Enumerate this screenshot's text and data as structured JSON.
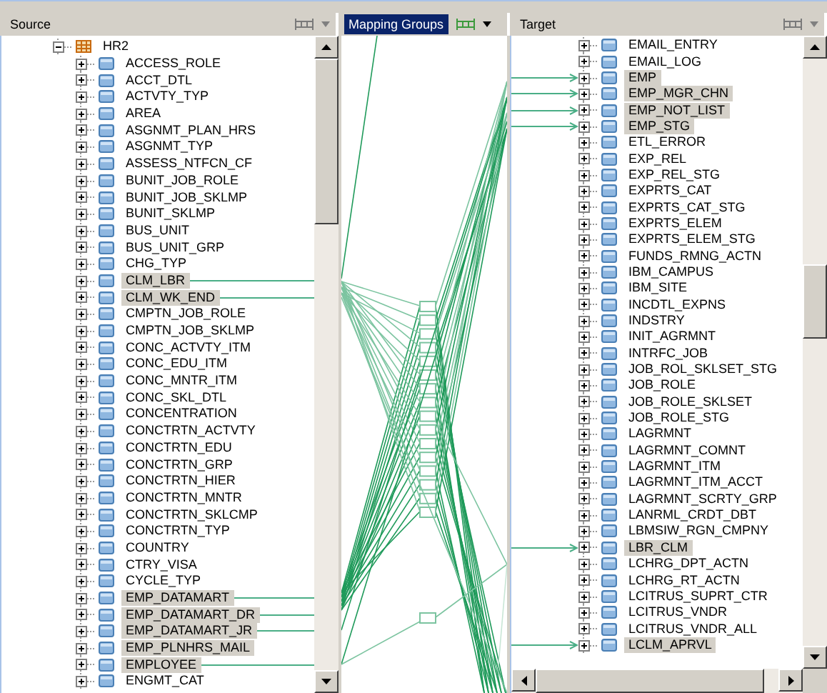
{
  "panes": [
    {
      "title": "Source",
      "selected": false
    },
    {
      "title": "Mapping Groups",
      "selected": true
    },
    {
      "title": "Target",
      "selected": false
    }
  ],
  "source": {
    "root": {
      "label": "HR2",
      "expanded": true,
      "children": [
        {
          "label": "ACCESS_ROLE",
          "expanded": false,
          "mapped": false,
          "linked": false
        },
        {
          "label": "ACCT_DTL",
          "expanded": false,
          "mapped": false,
          "linked": false
        },
        {
          "label": "ACTVTY_TYP",
          "expanded": false,
          "mapped": false,
          "linked": false
        },
        {
          "label": "AREA",
          "expanded": false,
          "mapped": false,
          "linked": false
        },
        {
          "label": "ASGNMT_PLAN_HRS",
          "expanded": false,
          "mapped": false,
          "linked": false
        },
        {
          "label": "ASGNMT_TYP",
          "expanded": false,
          "mapped": false,
          "linked": false
        },
        {
          "label": "ASSESS_NTFCN_CF",
          "expanded": false,
          "mapped": false,
          "linked": false
        },
        {
          "label": "BUNIT_JOB_ROLE",
          "expanded": false,
          "mapped": false,
          "linked": false
        },
        {
          "label": "BUNIT_JOB_SKLMP",
          "expanded": false,
          "mapped": false,
          "linked": false
        },
        {
          "label": "BUNIT_SKLMP",
          "expanded": false,
          "mapped": false,
          "linked": false
        },
        {
          "label": "BUS_UNIT",
          "expanded": false,
          "mapped": false,
          "linked": false
        },
        {
          "label": "BUS_UNIT_GRP",
          "expanded": false,
          "mapped": false,
          "linked": false
        },
        {
          "label": "CHG_TYP",
          "expanded": false,
          "mapped": false,
          "linked": false
        },
        {
          "label": "CLM_LBR",
          "expanded": false,
          "mapped": true,
          "linked": true
        },
        {
          "label": "CLM_WK_END",
          "expanded": false,
          "mapped": true,
          "linked": true
        },
        {
          "label": "CMPTN_JOB_ROLE",
          "expanded": false,
          "mapped": false,
          "linked": false
        },
        {
          "label": "CMPTN_JOB_SKLMP",
          "expanded": false,
          "mapped": false,
          "linked": false
        },
        {
          "label": "CONC_ACTVTY_ITM",
          "expanded": false,
          "mapped": false,
          "linked": false
        },
        {
          "label": "CONC_EDU_ITM",
          "expanded": false,
          "mapped": false,
          "linked": false
        },
        {
          "label": "CONC_MNTR_ITM",
          "expanded": false,
          "mapped": false,
          "linked": false
        },
        {
          "label": "CONC_SKL_DTL",
          "expanded": false,
          "mapped": false,
          "linked": false
        },
        {
          "label": "CONCENTRATION",
          "expanded": false,
          "mapped": false,
          "linked": false
        },
        {
          "label": "CONCTRTN_ACTVTY",
          "expanded": false,
          "mapped": false,
          "linked": false
        },
        {
          "label": "CONCTRTN_EDU",
          "expanded": false,
          "mapped": false,
          "linked": false
        },
        {
          "label": "CONCTRTN_GRP",
          "expanded": false,
          "mapped": false,
          "linked": false
        },
        {
          "label": "CONCTRTN_HIER",
          "expanded": false,
          "mapped": false,
          "linked": false
        },
        {
          "label": "CONCTRTN_MNTR",
          "expanded": false,
          "mapped": false,
          "linked": false
        },
        {
          "label": "CONCTRTN_SKLCMP",
          "expanded": false,
          "mapped": false,
          "linked": false
        },
        {
          "label": "CONCTRTN_TYP",
          "expanded": false,
          "mapped": false,
          "linked": false
        },
        {
          "label": "COUNTRY",
          "expanded": false,
          "mapped": false,
          "linked": false
        },
        {
          "label": "CTRY_VISA",
          "expanded": false,
          "mapped": false,
          "linked": false
        },
        {
          "label": "CYCLE_TYP",
          "expanded": false,
          "mapped": false,
          "linked": false
        },
        {
          "label": "EMP_DATAMART",
          "expanded": false,
          "mapped": true,
          "linked": true
        },
        {
          "label": "EMP_DATAMART_DR",
          "expanded": false,
          "mapped": true,
          "linked": true
        },
        {
          "label": "EMP_DATAMART_JR",
          "expanded": false,
          "mapped": true,
          "linked": true
        },
        {
          "label": "EMP_PLNHRS_MAIL",
          "expanded": false,
          "mapped": true,
          "linked": false
        },
        {
          "label": "EMPLOYEE",
          "expanded": false,
          "mapped": true,
          "linked": true
        },
        {
          "label": "ENGMT_CAT",
          "expanded": false,
          "mapped": false,
          "linked": false
        }
      ]
    }
  },
  "target": {
    "items": [
      {
        "label": "EMAIL_ENTRY",
        "expanded": false,
        "mapped": false,
        "linked": false
      },
      {
        "label": "EMAIL_LOG",
        "expanded": false,
        "mapped": false,
        "linked": false
      },
      {
        "label": "EMP",
        "expanded": false,
        "mapped": true,
        "linked": true
      },
      {
        "label": "EMP_MGR_CHN",
        "expanded": false,
        "mapped": true,
        "linked": true
      },
      {
        "label": "EMP_NOT_LIST",
        "expanded": false,
        "mapped": true,
        "linked": true
      },
      {
        "label": "EMP_STG",
        "expanded": false,
        "mapped": true,
        "linked": true
      },
      {
        "label": "ETL_ERROR",
        "expanded": false,
        "mapped": false,
        "linked": false
      },
      {
        "label": "EXP_REL",
        "expanded": false,
        "mapped": false,
        "linked": false
      },
      {
        "label": "EXP_REL_STG",
        "expanded": false,
        "mapped": false,
        "linked": false
      },
      {
        "label": "EXPRTS_CAT",
        "expanded": false,
        "mapped": false,
        "linked": false
      },
      {
        "label": "EXPRTS_CAT_STG",
        "expanded": false,
        "mapped": false,
        "linked": false
      },
      {
        "label": "EXPRTS_ELEM",
        "expanded": false,
        "mapped": false,
        "linked": false
      },
      {
        "label": "EXPRTS_ELEM_STG",
        "expanded": false,
        "mapped": false,
        "linked": false
      },
      {
        "label": "FUNDS_RMNG_ACTN",
        "expanded": false,
        "mapped": false,
        "linked": false
      },
      {
        "label": "IBM_CAMPUS",
        "expanded": false,
        "mapped": false,
        "linked": false
      },
      {
        "label": "IBM_SITE",
        "expanded": false,
        "mapped": false,
        "linked": false
      },
      {
        "label": "INCDTL_EXPNS",
        "expanded": false,
        "mapped": false,
        "linked": false
      },
      {
        "label": "INDSTRY",
        "expanded": false,
        "mapped": false,
        "linked": false
      },
      {
        "label": "INIT_AGRMNT",
        "expanded": false,
        "mapped": false,
        "linked": false
      },
      {
        "label": "INTRFC_JOB",
        "expanded": false,
        "mapped": false,
        "linked": false
      },
      {
        "label": "JOB_ROL_SKLSET_STG",
        "expanded": false,
        "mapped": false,
        "linked": false
      },
      {
        "label": "JOB_ROLE",
        "expanded": false,
        "mapped": false,
        "linked": false
      },
      {
        "label": "JOB_ROLE_SKLSET",
        "expanded": false,
        "mapped": false,
        "linked": false
      },
      {
        "label": "JOB_ROLE_STG",
        "expanded": false,
        "mapped": false,
        "linked": false
      },
      {
        "label": "LAGRMNT",
        "expanded": false,
        "mapped": false,
        "linked": false
      },
      {
        "label": "LAGRMNT_COMNT",
        "expanded": false,
        "mapped": false,
        "linked": false
      },
      {
        "label": "LAGRMNT_ITM",
        "expanded": false,
        "mapped": false,
        "linked": false
      },
      {
        "label": "LAGRMNT_ITM_ACCT",
        "expanded": false,
        "mapped": false,
        "linked": false
      },
      {
        "label": "LAGRMNT_SCRTY_GRP",
        "expanded": false,
        "mapped": false,
        "linked": false
      },
      {
        "label": "LANRML_CRDT_DBT",
        "expanded": false,
        "mapped": false,
        "linked": false
      },
      {
        "label": "LBMSIW_RGN_CMPNY",
        "expanded": false,
        "mapped": false,
        "linked": false
      },
      {
        "label": "LBR_CLM",
        "expanded": false,
        "mapped": true,
        "linked": true
      },
      {
        "label": "LCHRG_DPT_ACTN",
        "expanded": false,
        "mapped": false,
        "linked": false
      },
      {
        "label": "LCHRG_RT_ACTN",
        "expanded": false,
        "mapped": false,
        "linked": false
      },
      {
        "label": "LCITRUS_SUPRT_CTR",
        "expanded": false,
        "mapped": false,
        "linked": false
      },
      {
        "label": "LCITRUS_VNDR",
        "expanded": false,
        "mapped": false,
        "linked": false
      },
      {
        "label": "LCITRUS_VNDR_ALL",
        "expanded": false,
        "mapped": false,
        "linked": false
      },
      {
        "label": "LCLM_APRVL",
        "expanded": false,
        "mapped": true,
        "linked": true
      }
    ]
  }
}
